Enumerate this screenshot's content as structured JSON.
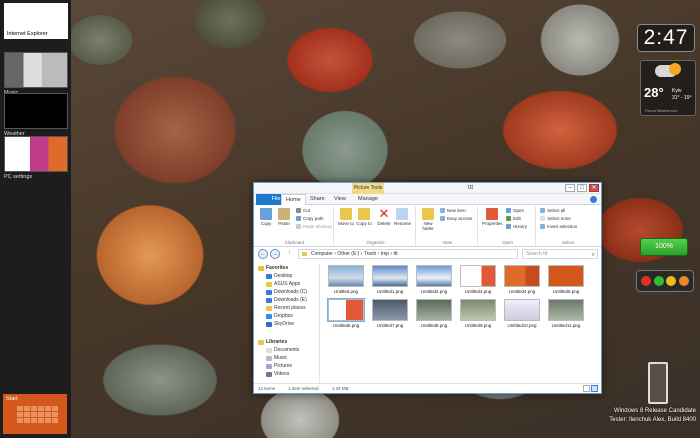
{
  "switcher": {
    "apps": [
      {
        "label": "Internet Explorer"
      },
      {
        "label": "Music"
      },
      {
        "label": "Weather"
      },
      {
        "label": "PC settings"
      }
    ],
    "start_label": "Start"
  },
  "gadgets": {
    "clock": "2:47",
    "weather": {
      "temp": "28°",
      "city": "Kyiv",
      "range": "31° - 19°",
      "source": "Foreca Weather.com"
    },
    "battery": "100%",
    "watermark_line1": "Windows 8 Release Candidate",
    "watermark_line2": "Tester: Ilenchuk Alex, Build 8400"
  },
  "explorer": {
    "title": "ttt",
    "context_tab": "Picture Tools",
    "tabs": [
      "File",
      "Home",
      "Share",
      "View",
      "Manage"
    ],
    "ribbon": {
      "clipboard": {
        "label": "Clipboard",
        "copy": "Copy",
        "paste": "Paste",
        "cut": "Cut",
        "copy_path": "Copy path",
        "paste_shortcut": "Paste shortcut"
      },
      "organize": {
        "label": "Organize",
        "move_to": "Move to",
        "copy_to": "Copy to",
        "delete": "Delete",
        "rename": "Rename"
      },
      "new": {
        "label": "New",
        "new_folder": "New folder",
        "new_item": "New item",
        "easy_access": "Easy access"
      },
      "open": {
        "label": "Open",
        "properties": "Properties",
        "open": "Open",
        "edit": "Edit",
        "history": "History"
      },
      "select": {
        "label": "Select",
        "select_all": "Select all",
        "select_none": "Select none",
        "invert": "Invert selection"
      }
    },
    "address": "Computer › Other (E:) › Trash › tmp › ttt",
    "search_placeholder": "Search ttt",
    "nav": {
      "favorites": "Favorites",
      "favorites_items": [
        "Desktop",
        "ASUS Apps",
        "Downloads (C)",
        "Downloads (E)",
        "Recent places",
        "Dropbox",
        "SkyDrive"
      ],
      "libraries": "Libraries",
      "libraries_items": [
        "Documents",
        "Music",
        "Pictures",
        "Videos"
      ]
    },
    "files": [
      "Untitled.png",
      "Untitled1.png",
      "Untitled2.png",
      "Untitled3.png",
      "Untitled4.png",
      "Untitled5.png",
      "Untitled6.png",
      "Untitled7.png",
      "Untitled8.png",
      "Untitled9.png",
      "Untitled10.png",
      "Untitled11.png"
    ],
    "status": {
      "count": "12 items",
      "selected": "1 item selected",
      "size": "1.25 MB"
    },
    "window_controls": {
      "min": "–",
      "max": "□",
      "close": "✕"
    },
    "nav_buttons": {
      "back": "←",
      "forward": "→",
      "up": "↑"
    },
    "search_icon": "⌕"
  }
}
